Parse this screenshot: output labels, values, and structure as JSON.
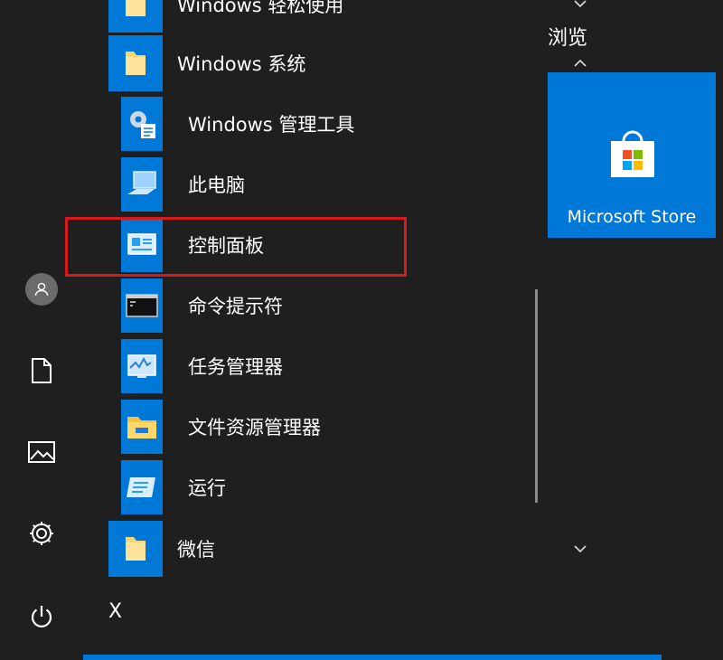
{
  "colors": {
    "background": "#1f1f1f",
    "accent": "#0078d7",
    "highlight_box": "#d7191c",
    "folder_yellow": "#f7d774"
  },
  "rail": {
    "items": [
      {
        "name": "user-avatar",
        "icon": "user-icon"
      },
      {
        "name": "documents",
        "icon": "document-icon"
      },
      {
        "name": "pictures",
        "icon": "picture-icon"
      },
      {
        "name": "settings",
        "icon": "gear-icon"
      },
      {
        "name": "power",
        "icon": "power-icon"
      }
    ]
  },
  "apps": {
    "groups": [
      {
        "label": "Windows 轻松使用",
        "icon": "folder-icon",
        "expanded": false
      },
      {
        "label": "Windows 系统",
        "icon": "folder-icon",
        "expanded": true
      },
      {
        "label": "微信",
        "icon": "folder-icon",
        "expanded": false
      }
    ],
    "system_items": [
      {
        "label": "Windows 管理工具",
        "icon": "admin-tools-icon"
      },
      {
        "label": "此电脑",
        "icon": "computer-icon"
      },
      {
        "label": "控制面板",
        "icon": "control-panel-icon",
        "highlighted": true
      },
      {
        "label": "命令提示符",
        "icon": "command-prompt-icon"
      },
      {
        "label": "任务管理器",
        "icon": "task-manager-icon"
      },
      {
        "label": "文件资源管理器",
        "icon": "file-explorer-icon"
      },
      {
        "label": "运行",
        "icon": "run-icon"
      }
    ],
    "letter_header": "X"
  },
  "tiles": {
    "section_title": "浏览",
    "store": {
      "label": "Microsoft Store",
      "icon": "store-bag-icon"
    }
  }
}
